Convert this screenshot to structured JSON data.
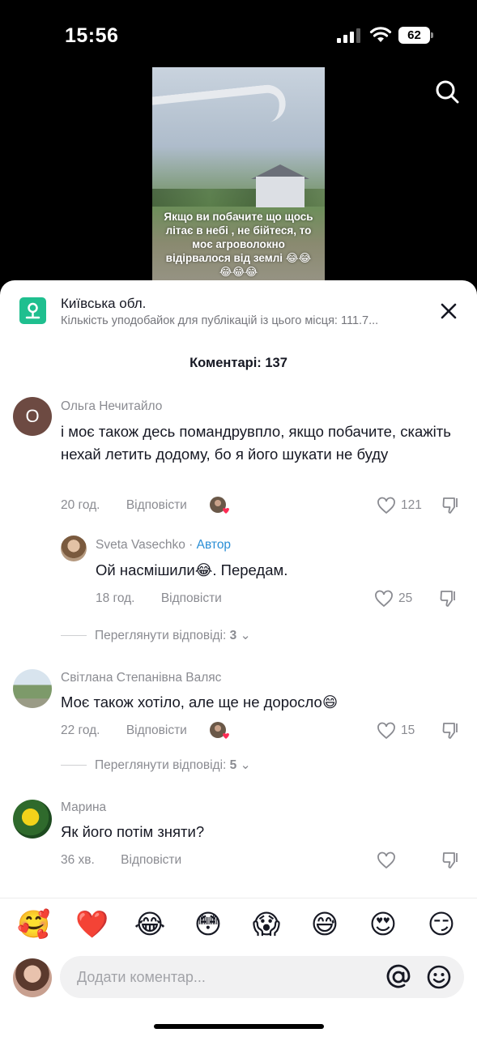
{
  "status_bar": {
    "time": "15:56",
    "battery": "62"
  },
  "video": {
    "caption": "Якщо ви побачите що щось літає в небі , не бійтеся, то моє агроволокно відірвалося від землі 😂😂😂😂😂"
  },
  "location": {
    "title": "Київська обл.",
    "subtitle": "Кількість уподобайок для публікацій із цього місця: 111.7..."
  },
  "comments_header": {
    "count_label": "Коментарі: 137"
  },
  "comments": [
    {
      "author": "Ольга Нечитайло",
      "avatar_letter": "О",
      "text": "і моє також десь помандрувпло, якщо побачите, скажіть нехай летить додому, бо я його шукати не буду",
      "time": "20 год.",
      "reply_label": "Відповісти",
      "likes": "121"
    },
    {
      "author": "Sveta Vasechko",
      "separator": " · ",
      "author_tag": "Автор",
      "text": "Ой насмішили😂. Передам.",
      "time": "18 год.",
      "reply_label": "Відповісти",
      "likes": "25"
    },
    {
      "author": "Світлана Степанівна Валяс",
      "text": "Моє також хотіло, але ще не доросло😄",
      "time": "22 год.",
      "reply_label": "Відповісти",
      "likes": "15"
    },
    {
      "author": "Марина",
      "text": "Як його потім зняти?",
      "time": "36 хв.",
      "reply_label": "Відповісти"
    }
  ],
  "view_replies": [
    {
      "label": "Переглянути відповіді:",
      "count": "3"
    },
    {
      "label": "Переглянути відповіді:",
      "count": "5"
    }
  ],
  "quick_emojis": [
    "🥰",
    "❤️",
    "😂",
    "😳",
    "😱",
    "😅",
    "😍",
    "😏"
  ],
  "composer": {
    "placeholder": "Додати коментар..."
  },
  "colors": {
    "accent_location": "#1fbf8f",
    "author_tag": "#2b8fd6",
    "muted": "#8a8b91"
  }
}
